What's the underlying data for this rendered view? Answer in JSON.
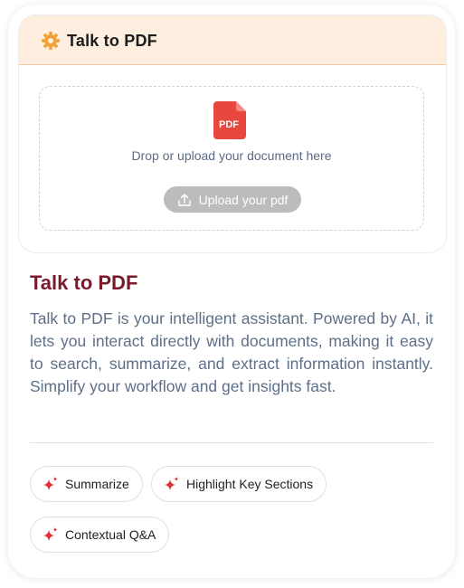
{
  "panel": {
    "title": "Talk to PDF",
    "icon": "gear-icon",
    "header_bg": "#fdeee0",
    "dropzone": {
      "file_badge": "PDF",
      "prompt": "Drop or upload your document here",
      "upload_label": "Upload your pdf"
    }
  },
  "info": {
    "title": "Talk to PDF",
    "description": "Talk to PDF is your intelligent assistant. Powered by AI, it lets you interact directly with documents, making it easy to search, summarize, and extract information instantly. Simplify your workflow and get insights fast."
  },
  "features": [
    {
      "label": "Summarize",
      "icon": "sparkle-icon"
    },
    {
      "label": "Highlight Key Sections",
      "icon": "sparkle-icon"
    },
    {
      "label": "Contextual Q&A",
      "icon": "sparkle-icon"
    }
  ],
  "colors": {
    "accent_orange": "#f2a23a",
    "pdf_red": "#e8473d",
    "title_maroon": "#7a1b2c",
    "sparkle_red": "#e0303a"
  }
}
